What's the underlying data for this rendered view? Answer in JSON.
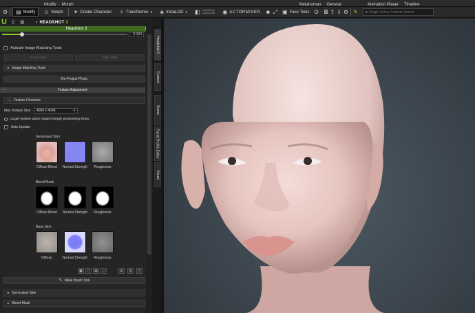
{
  "toolbar_top": {
    "items": [
      "Modify",
      "Morph",
      "Metahuman",
      "General",
      "Animation Player",
      "Timeline"
    ]
  },
  "toolbar_main": {
    "modify": "Modify",
    "morph": "Morph",
    "create_character": "Create Character",
    "transformer": "Transformer",
    "instalod": "InstaLOD",
    "substance_line1": "SUBSTANCE",
    "substance_line2": "CHARACTER",
    "actormixer": "ACTORMIXER",
    "face_tools": "Face Tools",
    "search_placeholder": "Single Online Content Search"
  },
  "panel_toolbar": {
    "logo": "U",
    "headshot": "HEADSHOT",
    "headshot_ver": "3"
  },
  "panel": {
    "title": "Headshot 3",
    "slider_value": "0.160",
    "slider_fraction": 0.16,
    "activate_label": "Activate Image Matching Tools",
    "btn_left": "Front View",
    "btn_right": "Side View",
    "image_matching_tools": "Image Matching Tools",
    "reproject": "Re-Project Photo",
    "texture_adjustment": "Texture Adjustment",
    "texture_channels": "Texture Channels",
    "max_texture_label": "Max Texture Size",
    "max_texture_value": "4096 x 4096",
    "info_text": "Larger texture sizes require longer processing times.",
    "auto_update": "Auto Update",
    "generated_skin": "Generated Skin",
    "blend_mask": "Blend Mask",
    "base_skin": "Base Skin",
    "gen_labels": [
      "Diffuse Blend",
      "Normal Strength",
      "Roughness"
    ],
    "blend_labels": [
      "Diffuse Blend",
      "Normal Strength",
      "Roughness"
    ],
    "base_labels": [
      "Diffuse",
      "Normal Strength",
      "Roughness"
    ],
    "mask_brush": "Mask Brush Tool",
    "section_generated_skin": "Generated Skin",
    "section_blend_mask": "Blend Mask"
  },
  "side_tabs": [
    "Headshot 3",
    "Content",
    "Scene",
    "Facial Profile Editor",
    "Visual"
  ],
  "colors": {
    "accent": "#8bd12a",
    "panel_header": "#3d6a1e",
    "viewport_bg": "#3b444c"
  }
}
